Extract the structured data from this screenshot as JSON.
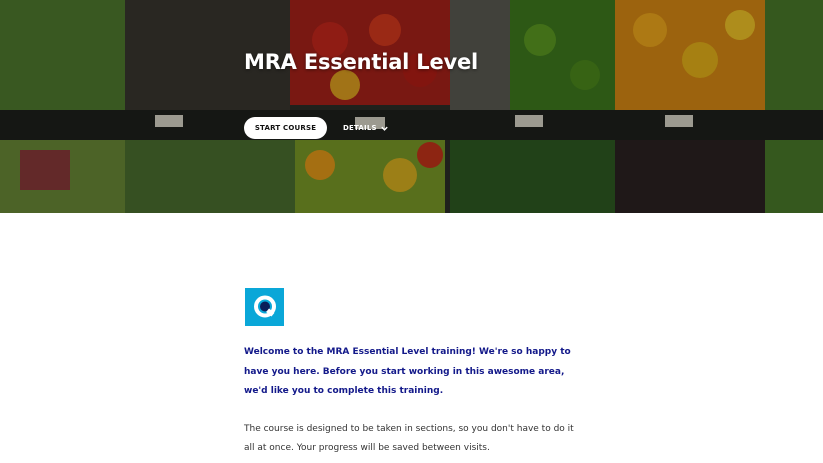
{
  "hero": {
    "title": "MRA Essential Level",
    "start_button": "START COURSE",
    "details_label": "DETAILS"
  },
  "brand": {
    "logo_icon": "q-logo-icon",
    "logo_color": "#0aa7d8"
  },
  "content": {
    "intro": "Welcome to the MRA Essential Level training! We're so happy to have you here. Before you start working in this awesome area, we'd like you to complete this training.",
    "body": "The course is designed to be taken in sections, so you don't have to do it all at once. Your progress will be saved between visits."
  },
  "colors": {
    "intro_text": "#13198a",
    "body_text": "#333333"
  }
}
